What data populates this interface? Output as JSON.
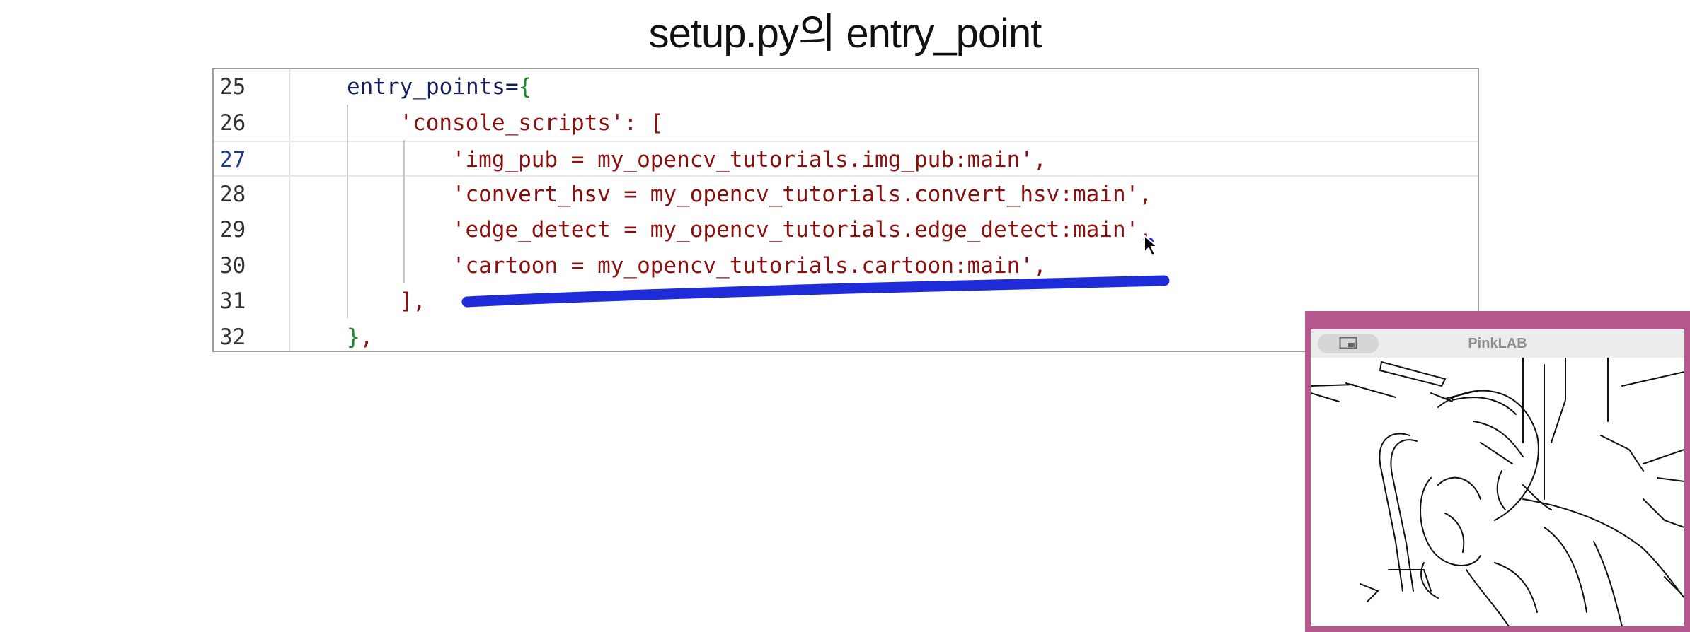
{
  "slide": {
    "title": "setup.py의 entry_point"
  },
  "editor": {
    "current_line": "27",
    "lines": [
      {
        "num": "25",
        "tokens": [
          {
            "t": "entry_points=",
            "c": "id"
          },
          {
            "t": "{",
            "c": "brace"
          }
        ]
      },
      {
        "num": "26",
        "tokens": [
          {
            "t": "'console_scripts'",
            "c": "str"
          },
          {
            "t": ": [",
            "c": "punct"
          }
        ]
      },
      {
        "num": "27",
        "tokens": [
          {
            "t": "'img_pub = my_opencv_tutorials.img_pub:main'",
            "c": "str"
          },
          {
            "t": ",",
            "c": "punct"
          }
        ]
      },
      {
        "num": "28",
        "tokens": [
          {
            "t": "'convert_hsv = my_opencv_tutorials.convert_hsv:main'",
            "c": "str"
          },
          {
            "t": ",",
            "c": "punct"
          }
        ]
      },
      {
        "num": "29",
        "tokens": [
          {
            "t": "'edge_detect = my_opencv_tutorials.edge_detect:main'",
            "c": "str"
          },
          {
            "t": ",",
            "c": "punct"
          }
        ]
      },
      {
        "num": "30",
        "tokens": [
          {
            "t": "'cartoon = my_opencv_tutorials.cartoon:main'",
            "c": "str"
          },
          {
            "t": ",",
            "c": "punct"
          }
        ]
      },
      {
        "num": "31",
        "tokens": [
          {
            "t": "],",
            "c": "punct"
          }
        ]
      },
      {
        "num": "32",
        "tokens": [
          {
            "t": "}",
            "c": "brace"
          },
          {
            "t": ",",
            "c": "punct"
          }
        ]
      }
    ]
  },
  "webcam": {
    "title": "PinkLAB",
    "frame_color": "#b5588e",
    "button_icon": "picture-in-picture-icon"
  },
  "annotation": {
    "stroke_color": "#1f2bd6"
  },
  "colors": {
    "identifier": "#14205c",
    "string": "#8a1010",
    "brace": "#1d8a2c"
  }
}
